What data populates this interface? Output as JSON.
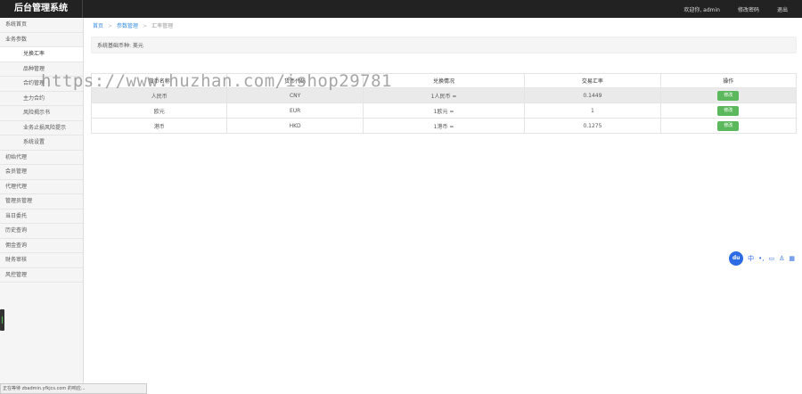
{
  "header": {
    "logo": "后台管理系统",
    "welcome": "欢迎你, admin",
    "change_password": "修改密码",
    "logout": "退出"
  },
  "sidebar": {
    "items": [
      {
        "label": "系统首页",
        "level": 1
      },
      {
        "label": "业务参数",
        "level": 1
      },
      {
        "label": "兑换汇率",
        "level": 2,
        "active": true
      },
      {
        "label": "品种管理",
        "level": 2
      },
      {
        "label": "合约管理",
        "level": 2
      },
      {
        "label": "主力合约",
        "level": 2
      },
      {
        "label": "风险揭示书",
        "level": 2
      },
      {
        "label": "业务止损风险提示",
        "level": 2
      },
      {
        "label": "系统设置",
        "level": 2
      },
      {
        "label": "初始代理",
        "level": 1
      },
      {
        "label": "会员管理",
        "level": 1
      },
      {
        "label": "代理代理",
        "level": 1
      },
      {
        "label": "管理员管理",
        "level": 1
      },
      {
        "label": "当日委托",
        "level": 1
      },
      {
        "label": "历史查询",
        "level": 1
      },
      {
        "label": "佣金查询",
        "level": 1
      },
      {
        "label": "财务审核",
        "level": 1
      },
      {
        "label": "风控管理",
        "level": 1
      }
    ]
  },
  "breadcrumb": {
    "home": "首页",
    "parent": "参数管理",
    "current": "汇率管理"
  },
  "notice": "系统基础币种: 美元",
  "table": {
    "headers": [
      "货币名称",
      "货币代码",
      "兑换情况",
      "交易汇率",
      "操作"
    ],
    "rows": [
      {
        "name": "人民币",
        "code": "CNY",
        "exchange": "1人民币 =",
        "rate": "0.1449",
        "action": "修改"
      },
      {
        "name": "欧元",
        "code": "EUR",
        "exchange": "1欧元 =",
        "rate": "1",
        "action": "修改"
      },
      {
        "name": "港币",
        "code": "HKD",
        "exchange": "1港币 =",
        "rate": "0.1275",
        "action": "修改"
      }
    ]
  },
  "watermark": "https://www.huzhan.com/ishop29781",
  "baidu_bar": {
    "logo": "du",
    "ime": "中"
  },
  "status_bar": "正在等待 zbadmin.yfkjcs.com 的响应..."
}
